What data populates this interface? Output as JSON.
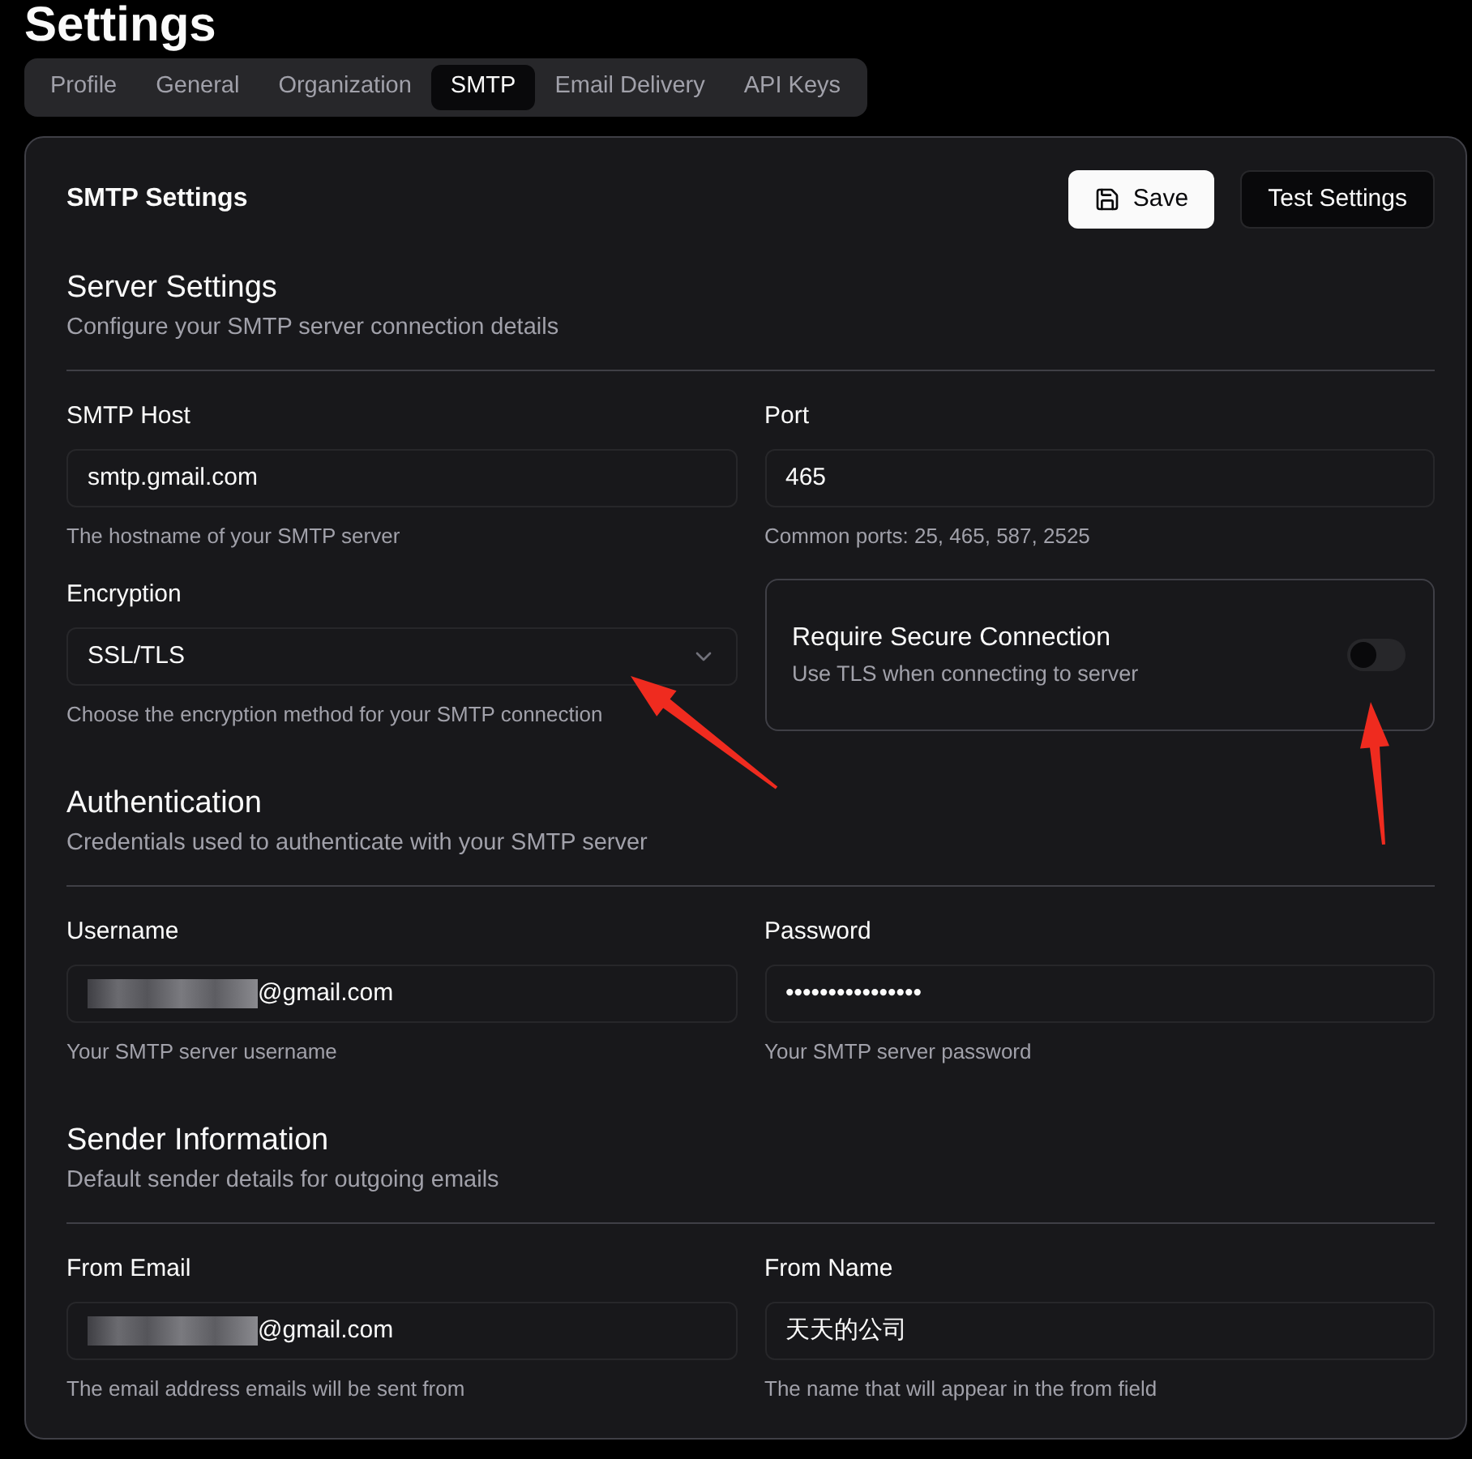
{
  "page_title": "Settings",
  "tabs": [
    {
      "label": "Profile",
      "selected": false
    },
    {
      "label": "General",
      "selected": false
    },
    {
      "label": "Organization",
      "selected": false
    },
    {
      "label": "SMTP",
      "selected": true
    },
    {
      "label": "Email Delivery",
      "selected": false
    },
    {
      "label": "API Keys",
      "selected": false
    }
  ],
  "card": {
    "title": "SMTP Settings",
    "buttons": [
      {
        "label": "Save",
        "kind": "primary"
      },
      {
        "label": "Test Settings",
        "kind": "secondary"
      }
    ]
  },
  "sections": [
    {
      "title": "Server Settings",
      "description": "Configure your SMTP server connection details",
      "fields": [
        {
          "kind": "input",
          "label": "SMTP Host",
          "value": "smtp.gmail.com",
          "help": "The hostname of your SMTP server",
          "redacted": false
        },
        {
          "kind": "input",
          "label": "Port",
          "value": "465",
          "help": "Common ports: 25, 465, 587, 2525",
          "redacted": false
        },
        {
          "kind": "select",
          "label": "Encryption",
          "value": "SSL/TLS",
          "help": "Choose the encryption method for your SMTP connection",
          "arrow": true
        },
        {
          "kind": "switch",
          "label": "Require Secure Connection",
          "description": "Use TLS when connecting to server",
          "on": false,
          "arrow": true
        }
      ]
    },
    {
      "title": "Authentication",
      "description": "Credentials used to authenticate with your SMTP server",
      "fields": [
        {
          "kind": "input",
          "label": "Username",
          "value": "@gmail.com",
          "help": "Your SMTP server username",
          "redacted": true
        },
        {
          "kind": "input",
          "label": "Password",
          "value": "••••••••••••••••",
          "help": "Your SMTP server password",
          "redacted": false
        }
      ]
    },
    {
      "title": "Sender Information",
      "description": "Default sender details for outgoing emails",
      "fields": [
        {
          "kind": "input",
          "label": "From Email",
          "value": "@gmail.com",
          "help": "The email address emails will be sent from",
          "redacted": true
        },
        {
          "kind": "input",
          "label": "From Name",
          "value": "天天的公司",
          "help": "The name that will appear in the from field",
          "redacted": false
        }
      ]
    }
  ]
}
